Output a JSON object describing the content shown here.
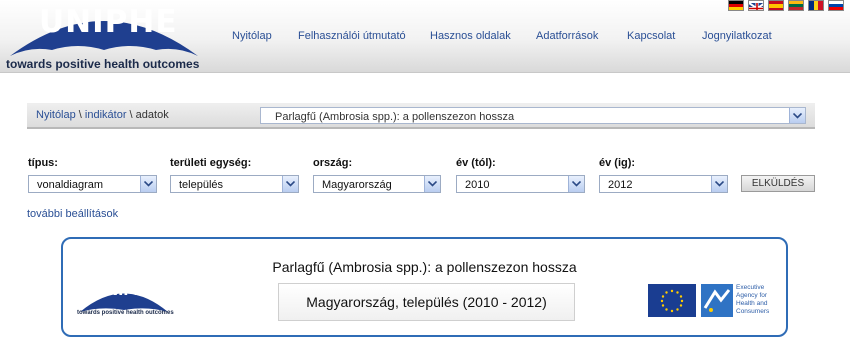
{
  "header": {
    "logo_text": "UNIPHE",
    "logo_tagline": "towards positive health outcomes",
    "nav": [
      "Nyitólap",
      "Felhasználói útmutató",
      "Hasznos oldalak",
      "Adatforrások",
      "Kapcsolat",
      "Jognyilatkozat"
    ],
    "flags": [
      "german-flag-icon",
      "uk-flag-icon",
      "spanish-flag-icon",
      "lithuanian-flag-icon",
      "romanian-flag-icon",
      "slovenian-flag-icon"
    ]
  },
  "breadcrumb": {
    "home": "Nyitólap",
    "sep1": " \\ ",
    "indicator": "indikátor",
    "sep2": " \\ ",
    "current": "adatok"
  },
  "indicator_select": {
    "value": "Parlagfű (Ambrosia spp.): a pollenszezon hossza"
  },
  "filters": {
    "type": {
      "label": "típus:",
      "value": "vonaldiagram"
    },
    "area": {
      "label": "területi egység:",
      "value": "település"
    },
    "country": {
      "label": "ország:",
      "value": "Magyarország"
    },
    "year_from": {
      "label": "év (tól):",
      "value": "2010"
    },
    "year_to": {
      "label": "év (ig):",
      "value": "2012"
    },
    "submit": "ELKÜLDÉS"
  },
  "more_settings": "további beállítások",
  "chart_panel": {
    "title": "Parlagfű (Ambrosia spp.): a pollenszezon hossza",
    "subtitle": "Magyarország, település (2010 - 2012)",
    "small_logo_text": "UNIPHE",
    "small_logo_tagline": "towards positive health outcomes",
    "eahc_text": [
      "Executive",
      "Agency for",
      "Health and",
      "Consumers"
    ]
  },
  "colors": {
    "link": "#2a4f95",
    "panel_border": "#2f6cb6",
    "logo_blue": "#1f3f8f"
  }
}
